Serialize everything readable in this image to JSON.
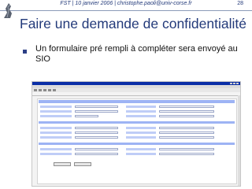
{
  "slide": {
    "header_text": "FST | 10 janvier 2006 | christophe.paoli@univ-corse.fr",
    "page_number": "28",
    "title": "Faire une demande de confidentialité",
    "bullet_text": "Un formulaire pré rempli à compléter sera envoyé au SIO"
  },
  "screenshot": {
    "description_colors": {
      "window_titlebar": "#0a2ea6",
      "form_band": "#9db3f4",
      "form_label": "#bfcdf7"
    },
    "buttons": [
      "",
      ""
    ]
  }
}
